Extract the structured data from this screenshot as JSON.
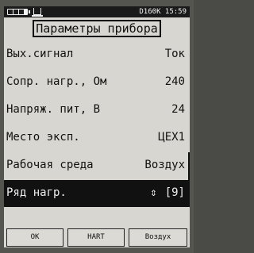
{
  "status": {
    "device": "D160K",
    "time": "15:59"
  },
  "title": "Параметры прибора",
  "params": [
    {
      "label": "Вых.сигнал",
      "value": "Ток"
    },
    {
      "label": "Сопр. нагр., Ом",
      "value": "240"
    },
    {
      "label": "Напряж. пит, В",
      "value": "24"
    },
    {
      "label": "Место эксп.",
      "value": "ЦЕХ1"
    },
    {
      "label": "Рабочая среда",
      "value": "Воздух"
    },
    {
      "label": "Ряд нагр.",
      "value": "[9]",
      "arrows": "⇕"
    }
  ],
  "softkeys": [
    "ОК",
    "HART",
    "Воздух"
  ],
  "icons": [
    "battery-icon",
    "memory-card-icon",
    "up-down-arrows-icon"
  ]
}
